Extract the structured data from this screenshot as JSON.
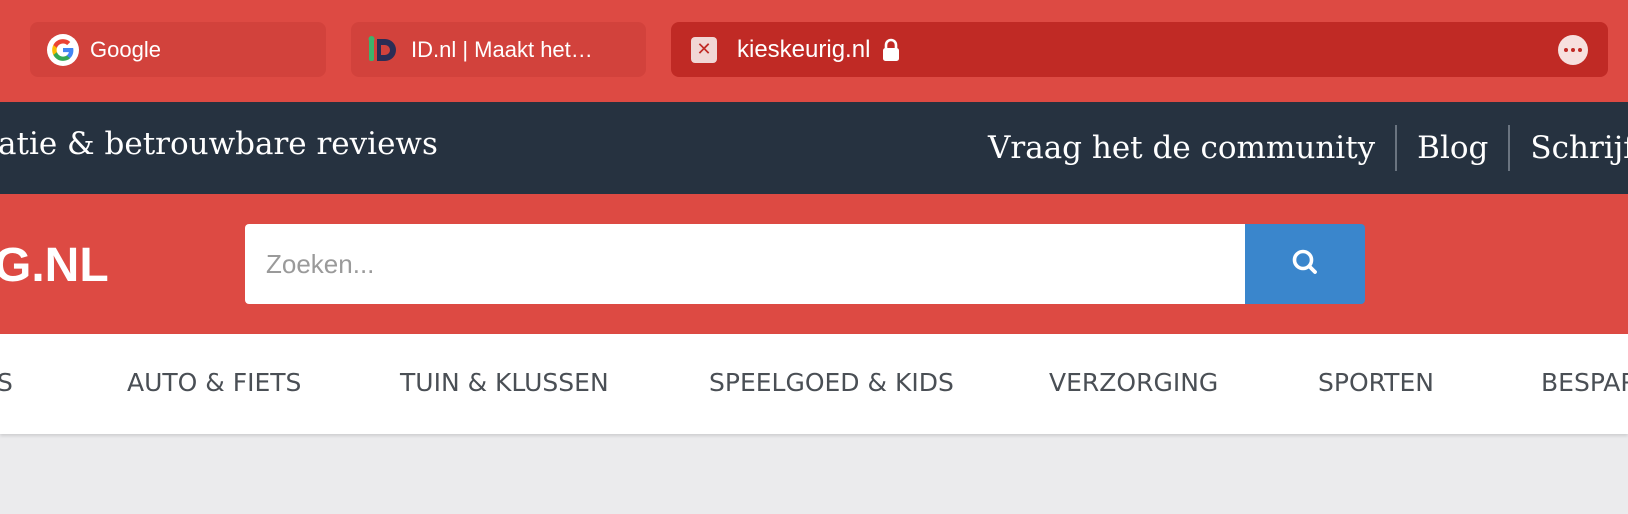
{
  "tabs": [
    {
      "label": "Google",
      "icon": "google-icon"
    },
    {
      "label": "ID.nl | Maakt het…",
      "icon": "id-nl-icon"
    },
    {
      "label": "kieskeurig.nl",
      "icon": "kieskeurig-favicon",
      "active": true
    }
  ],
  "tab_more_icon": "more-icon",
  "topbar": {
    "tagline": "atie & betrouwbare reviews",
    "links": [
      "Vraag het de community",
      "Blog",
      "Schrijf een"
    ]
  },
  "header": {
    "logo": "G.NL",
    "search_placeholder": "Zoeken...",
    "search_icon": "search-icon"
  },
  "categories": [
    "S",
    "AUTO & FIETS",
    "TUIN & KLUSSEN",
    "SPEELGOED & KIDS",
    "VERZORGING",
    "SPORTEN",
    "BESPAR"
  ],
  "colors": {
    "brand_red": "#dd4a43",
    "active_tab": "#c02a25",
    "dark_bar": "#263240",
    "search_button": "#3a86cc",
    "page_bg": "#ebebed"
  }
}
